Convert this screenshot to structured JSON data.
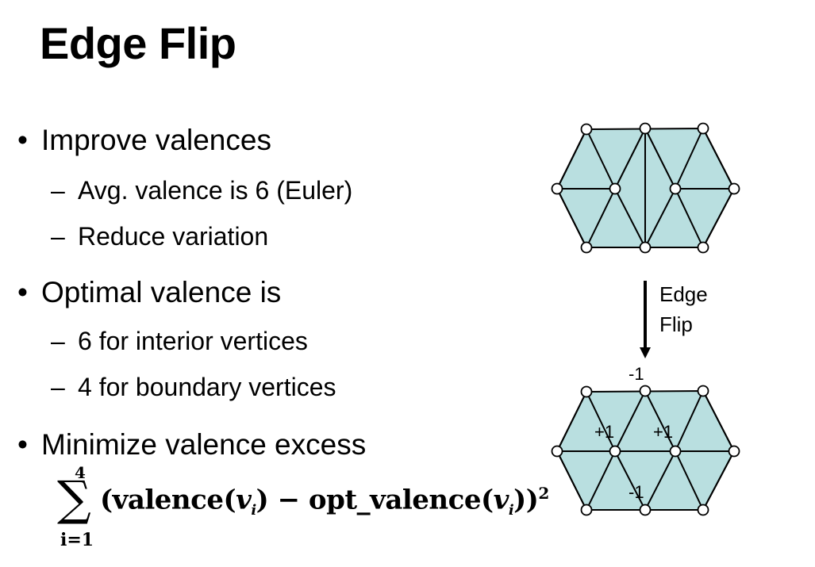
{
  "title": "Edge Flip",
  "bullets": [
    {
      "text": "Improve valences",
      "subs": [
        "Avg. valence is 6 (Euler)",
        "Reduce variation"
      ]
    },
    {
      "text": "Optimal valence is",
      "subs": [
        "6 for interior vertices",
        "4 for boundary vertices"
      ]
    },
    {
      "text": "Minimize valence excess",
      "subs": []
    }
  ],
  "bullet_symbol": "•",
  "dash_symbol": "–",
  "formula": {
    "sum_upper": "4",
    "sum_lower": "i=1",
    "sigma": "∑",
    "expression": "(valence(v_i) − opt_valence(v_i))²"
  },
  "diagram": {
    "arrow_label_line1": "Edge",
    "arrow_label_line2": "Flip",
    "valence_changes": [
      "-1",
      "+1",
      "+1",
      "-1"
    ],
    "fill_color": "#b9dfe0",
    "line_color": "#000000"
  }
}
